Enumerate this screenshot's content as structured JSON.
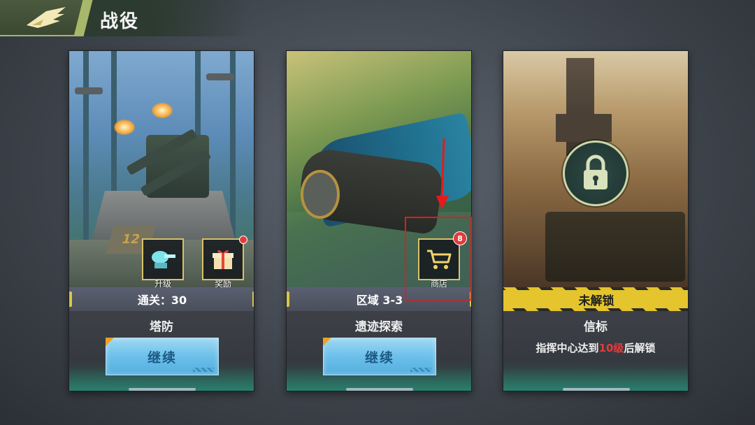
{
  "header": {
    "title": "战役"
  },
  "cards": [
    {
      "info": "通关：30",
      "mode_name": "塔防",
      "button_label": "继续",
      "actions": [
        {
          "label": "升级",
          "icon": "turret-icon"
        },
        {
          "label": "奖励",
          "icon": "gift-icon"
        }
      ]
    },
    {
      "info": "区域 3-3",
      "mode_name": "遗迹探索",
      "button_label": "继续",
      "shop": {
        "label": "商店",
        "badge": "8"
      }
    },
    {
      "status": "未解锁",
      "mode_name": "信标",
      "unlock_prefix": "指挥中心达到",
      "unlock_level": "10级",
      "unlock_suffix": "后解锁"
    }
  ],
  "colors": {
    "accent_gold": "#d9c26a",
    "button_blue": "#6cc0ea",
    "badge_red": "#e23b3b",
    "annotation_red": "#e31b1b",
    "locked_yellow": "#e4c52d"
  }
}
